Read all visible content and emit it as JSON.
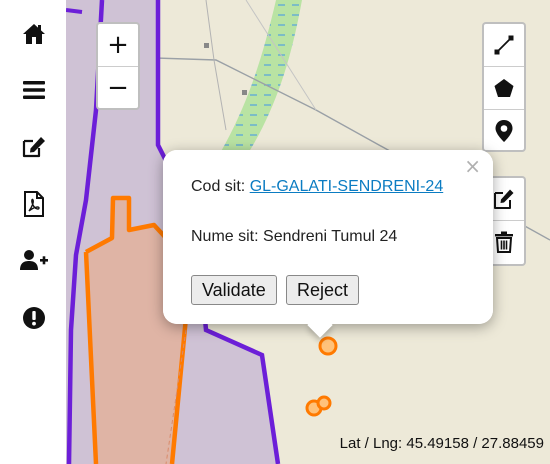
{
  "sidebar": {
    "items": [
      {
        "icon": "home-icon"
      },
      {
        "icon": "menu-icon"
      },
      {
        "icon": "edit-icon"
      },
      {
        "icon": "pdf-icon"
      },
      {
        "icon": "add-user-icon"
      },
      {
        "icon": "alert-icon"
      }
    ]
  },
  "zoom": {
    "in_label": "+",
    "out_label": "−"
  },
  "draw_tools": [
    {
      "icon": "polyline-icon"
    },
    {
      "icon": "polygon-icon"
    },
    {
      "icon": "marker-icon"
    }
  ],
  "edit_tools": [
    {
      "icon": "edit-layer-icon"
    },
    {
      "icon": "trash-icon"
    }
  ],
  "popup": {
    "close_label": "×",
    "cod_label": "Cod sit: ",
    "cod_value": "GL-GALATI-SENDRENI-24",
    "nume_label": "Nume sit: ",
    "nume_value": "Sendreni Tumul 24",
    "validate_label": "Validate",
    "reject_label": "Reject"
  },
  "coords": {
    "text": "Lat / Lng: 45.49158 / 27.88459"
  },
  "colors": {
    "map_bg": "#ede9d8",
    "corridor": "#cfc2d5",
    "purple_line": "#6c1fd8",
    "orange_line": "#ff7a00",
    "orange_fill": "#e2b29c",
    "green_band": "#b9e3a3",
    "link": "#0b7cc2"
  }
}
